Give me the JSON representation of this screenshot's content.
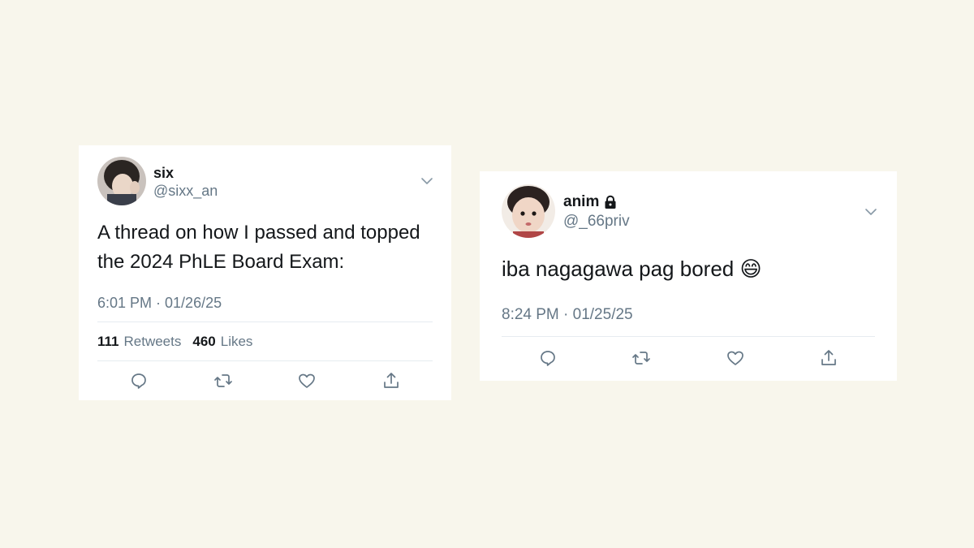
{
  "tweets": [
    {
      "name": "six",
      "handle": "@sixx_an",
      "locked": false,
      "text_line1": "A thread on how I passed and topped",
      "text_line2": "the 2024 PhLE Board Exam:",
      "time": "6:01 PM · 01/26/25",
      "retweets": "111",
      "retweets_label": "Retweets",
      "likes": "460",
      "likes_label": "Likes"
    },
    {
      "name": "anim",
      "handle": "@_66priv",
      "locked": true,
      "text": "iba nagagawa pag bored",
      "emoji": "😄",
      "time": "8:24 PM · 01/25/25"
    }
  ],
  "icons": [
    "chevron-down-icon",
    "reply-icon",
    "retweet-icon",
    "like-icon",
    "share-icon",
    "lock-icon"
  ],
  "colors": {
    "background": "#f8f6ec",
    "muted": "#657786",
    "text": "#14171a",
    "divider": "#e6ecf0"
  }
}
